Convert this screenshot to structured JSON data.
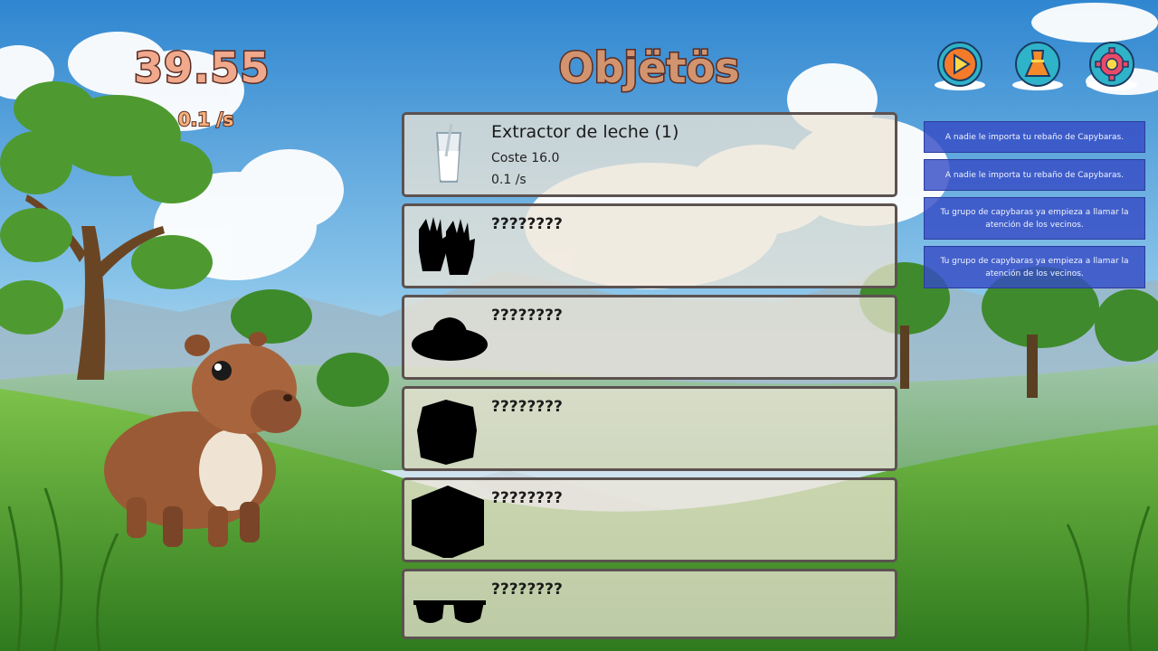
{
  "hud": {
    "score": "39.55",
    "rate": "0.1 /s",
    "title": "Objëtös"
  },
  "top_buttons": [
    {
      "icon": "play-icon"
    },
    {
      "icon": "dress-icon"
    },
    {
      "icon": "settings-gear-icon"
    }
  ],
  "items": [
    {
      "name": "Extractor de leche (1)",
      "cost": "Coste 16.0",
      "production": "0.1 /s",
      "icon": "milk-glass-icon",
      "locked": false
    },
    {
      "name": "????????",
      "icon": "gloves-silhouette-icon",
      "locked": true
    },
    {
      "name": "????????",
      "icon": "hat-silhouette-icon",
      "locked": true
    },
    {
      "name": "????????",
      "icon": "box-silhouette-icon",
      "locked": true
    },
    {
      "name": "????????",
      "icon": "cube-silhouette-icon",
      "locked": true
    },
    {
      "name": "????????",
      "icon": "sunglasses-silhouette-icon",
      "locked": true
    }
  ],
  "notifications": [
    "A nadie le importa tu rebaño de Capybaras.",
    "A nadie le importa tu rebaño de Capybaras.",
    "Tu grupo de capybaras ya empieza a llamar la atención de los vecinos.",
    "Tu grupo de capybaras ya empieza a llamar la atención de los vecinos."
  ],
  "colors": {
    "sky_top": "#2f86d0",
    "grass": "#4f9a2f",
    "panel_border": "#5c5250",
    "notification_bg": "#3a52c4",
    "title_fill": "#d1946e",
    "title_stroke": "#5b2c22"
  }
}
